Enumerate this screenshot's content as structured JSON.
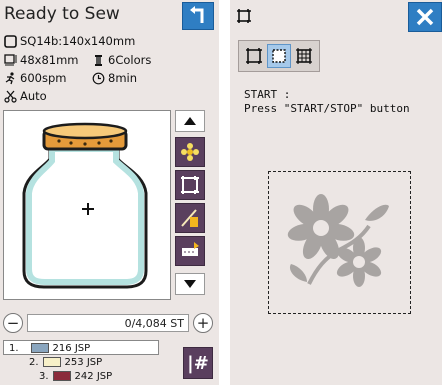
{
  "left": {
    "title": "Ready to Sew",
    "hoop": "SQ14b:140x140mm",
    "size": "48x81mm",
    "colors": "6Colors",
    "speed": "600spm",
    "time": "8min",
    "thread_trim": "Auto",
    "stitch_counter": "0/4,084 ST",
    "minus": "−",
    "plus": "+",
    "color_list": [
      {
        "index": "1.",
        "label": "216 JSP",
        "color": "#8aa6bf"
      },
      {
        "index": "2.",
        "label": "253 JSP",
        "color": "#f7f0c8"
      },
      {
        "index": "3.",
        "label": "242 JSP",
        "color": "#8b2b3b"
      }
    ],
    "hash_label": "|#",
    "back_icon": "return-arrow-icon"
  },
  "right": {
    "start_line1": "START :",
    "start_line2": "Press \"START/STOP\" button",
    "close_icon": "close-icon"
  },
  "colors": {
    "panel_bg": "#ece6e4",
    "accent_blue": "#2f7ec3",
    "tool_purple": "#5a3f5e",
    "flower_gray": "#a8a4a2",
    "jar_outline": "#b5e2e0",
    "lid_orange": "#e49a3a"
  }
}
